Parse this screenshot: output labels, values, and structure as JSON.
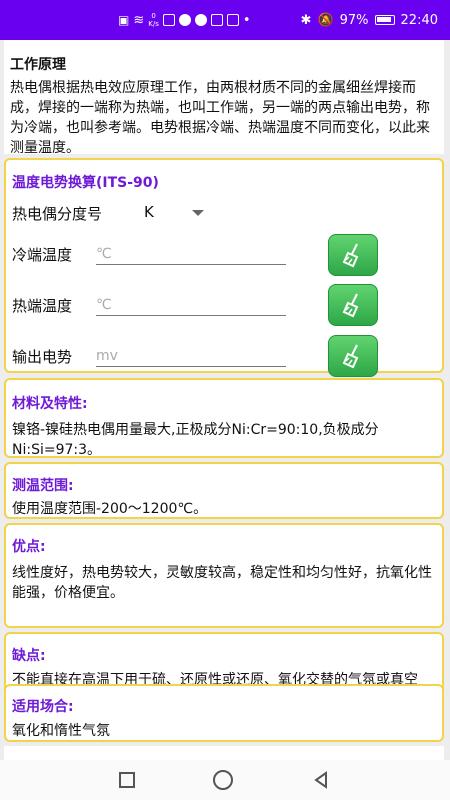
{
  "status_bar": {
    "net_speed_value": "0",
    "net_speed_unit": "K/s",
    "battery": "97%",
    "time": "22:40"
  },
  "intro": {
    "title": "工作原理",
    "text": "热电偶根据热电效应原理工作，由两根材质不同的金属细丝焊接而成，焊接的一端称为热端，也叫工作端，另一端的两点输出电势，称为冷端，也叫参考端。电势根据冷端、热端温度不同而变化，以此来测量温度。"
  },
  "calculator": {
    "title": "温度电势换算(ITS-90)",
    "type_label": "热电偶分度号",
    "type_value": "K",
    "cold_label": "冷端温度",
    "cold_placeholder": "℃",
    "hot_label": "热端温度",
    "hot_placeholder": "℃",
    "output_label": "输出电势",
    "output_placeholder": "mv"
  },
  "materials": {
    "title": "材料及特性:",
    "text": "镍铬-镍硅热电偶用量最大,正极成分Ni:Cr=90:10,负极成分Ni:Si=97:3。"
  },
  "range": {
    "title": "测温范围:",
    "text": "使用温度范围-200～1200℃。"
  },
  "advantages": {
    "title": "优点:",
    "text": "线性度好，热电势较大，灵敏度较高，稳定性和均匀性好，抗氧化性能强，价格便宜。"
  },
  "disadvantages": {
    "title": "缺点:",
    "text": "不能直接在高温下用于硫、还原性或还原、氧化交替的气氛或真空中，不推荐用于弱氧化气氛中。"
  },
  "applications": {
    "title": "适用场合:",
    "text": "氧化和惰性气氛"
  }
}
